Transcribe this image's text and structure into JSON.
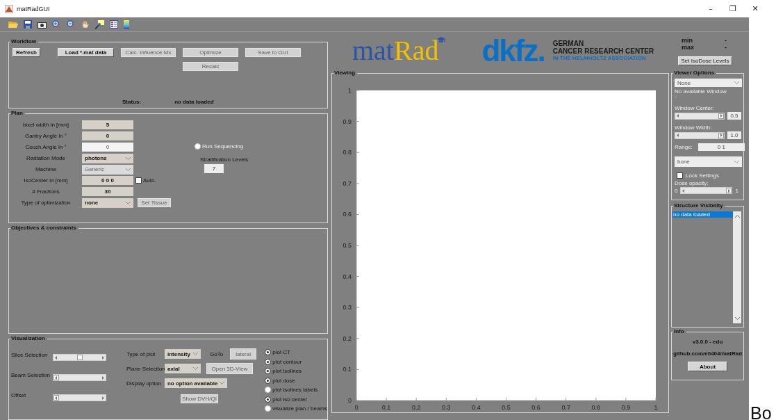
{
  "window": {
    "title": "matRadGUI",
    "controls": [
      "–",
      "❐",
      "✕"
    ]
  },
  "workflow": {
    "title": "Workflow",
    "buttons": [
      {
        "label": "Refresh",
        "disabled": false
      },
      {
        "label": "Load  *.mat data",
        "disabled": false
      },
      {
        "label": "Calc. Influence Mx",
        "disabled": true
      },
      {
        "label": "Optimize",
        "disabled": true
      },
      {
        "label": "Save to GUI",
        "disabled": true
      },
      {
        "label": "Recalc",
        "disabled": true
      }
    ],
    "status_label": "Status:",
    "status": "no data loaded"
  },
  "plan": {
    "title": "Plan",
    "fields": [
      {
        "label": "bixel width in [mm]",
        "kind": "edit",
        "value": "5",
        "disabled": false
      },
      {
        "label": "Gantry Angle in °",
        "kind": "edit",
        "value": "0",
        "disabled": false
      },
      {
        "label": "Couch Angle in °",
        "kind": "edit",
        "value": "0",
        "disabled": true
      },
      {
        "label": "Radiation Mode",
        "kind": "popup",
        "value": "photons",
        "disabled": false
      },
      {
        "label": "Machine",
        "kind": "popup",
        "value": "Generic",
        "disabled": true
      },
      {
        "label": "IsoCenter in [mm]",
        "kind": "edit",
        "value": "0 0 0",
        "disabled": false,
        "checkbox": {
          "label": "Auto.",
          "checked": false
        }
      },
      {
        "label": "# Fractions",
        "kind": "edit",
        "value": "30",
        "disabled": false
      },
      {
        "label": "Type of optimization",
        "kind": "popup",
        "value": "none",
        "disabled": false,
        "button": {
          "label": "Set Tissue",
          "disabled": true
        }
      }
    ],
    "sequencing": {
      "label": "Run Sequencing",
      "selected": false,
      "disabled": true
    },
    "stratification": {
      "label": "Stratification Levels",
      "value": "7"
    }
  },
  "objectives": {
    "title": "Objectives & constraints"
  },
  "visualization": {
    "title": "Visualization",
    "sliders": [
      {
        "label": "Slice Selection",
        "level": 0.5
      },
      {
        "label": "Beam Selection",
        "level": 0
      },
      {
        "label": "Offset",
        "level": 0
      }
    ],
    "options": [
      {
        "label": "Type of plot",
        "value": "intensity",
        "goto": "GoTo",
        "button": {
          "label": "lateral",
          "disabled": true
        }
      },
      {
        "label": "Plane Selection",
        "value": "axial",
        "button": {
          "label": "Open 3D-View",
          "disabled": true
        }
      },
      {
        "label": "Display option",
        "value": "no option available"
      }
    ],
    "dvh_button": {
      "label": "Show DVH/QI",
      "disabled": true
    },
    "toggles": [
      {
        "label": "plot CT",
        "checked": true
      },
      {
        "label": "plot contour",
        "checked": true
      },
      {
        "label": "plot isolines",
        "checked": true
      },
      {
        "label": "plot dose",
        "checked": true
      },
      {
        "label": "plot isolines labels",
        "checked": false
      },
      {
        "label": "plot iso center",
        "checked": true
      },
      {
        "label": "visualize plan / beams",
        "checked": false
      }
    ]
  },
  "logos": {
    "matrad": [
      "mat",
      "Rad"
    ],
    "dkfz": "dkfz.",
    "dkfz_lines": [
      "GERMAN",
      "CANCER RESEARCH CENTER",
      "IN THE HELMHOLTZ ASSOCIATION"
    ]
  },
  "viewing": {
    "title": "Viewing",
    "chart_data": {
      "type": "line",
      "xlim": [
        0,
        1
      ],
      "ylim": [
        0,
        1
      ],
      "xticks": [
        0,
        0.1,
        0.2,
        0.3,
        0.4,
        0.5,
        0.6,
        0.7,
        0.8,
        0.9,
        1
      ],
      "yticks": [
        0,
        0.1,
        0.2,
        0.3,
        0.4,
        0.5,
        0.6,
        0.7,
        0.8,
        0.9,
        1
      ]
    }
  },
  "dose_range": [
    {
      "label": "min",
      "value": "-"
    },
    {
      "label": "max",
      "value": "-"
    }
  ],
  "isodose_button": "Set IsoDose Levels",
  "viewer_options": {
    "title": "Viewer Options",
    "disabled": true,
    "source": "None",
    "window_preset": "No available Window",
    "window_preset_sub": "-",
    "sliders": [
      {
        "label": "Window Center:",
        "level": 1,
        "value": "0.5"
      },
      {
        "label": "Window Width:",
        "level": 1,
        "value": "1.0"
      }
    ],
    "range": {
      "label": "Range:",
      "value": "0 1"
    },
    "colormap": "bone",
    "lock": {
      "label": "Lock Settings",
      "checked": false
    },
    "opacity": {
      "label": "Dose opacity:",
      "min": "0",
      "max": "1",
      "level": 1
    }
  },
  "structures": {
    "title": "Structure Visibility",
    "items": [
      {
        "label": "no data loaded",
        "selected": true
      }
    ]
  },
  "info": {
    "title": "Info",
    "version": "v3.0.0 - edu",
    "link": "github.com/e0404/matRad",
    "about": "About"
  },
  "outside_text": "Bo"
}
